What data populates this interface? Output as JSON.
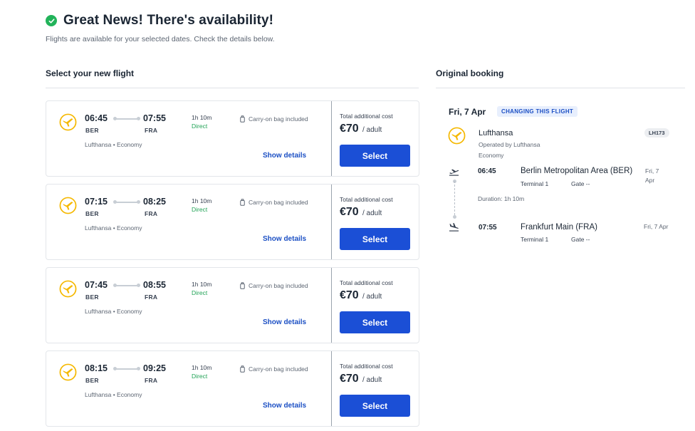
{
  "header": {
    "title": "Great News! There's availability!",
    "subtitle": "Flights are available for your selected dates. Check the details below."
  },
  "sections": {
    "new_flight": "Select your new flight",
    "original": "Original booking"
  },
  "colors": {
    "accent": "#1b4fd6",
    "success": "#22b35a",
    "logo": "#f5b800"
  },
  "flights": [
    {
      "dep_time": "06:45",
      "dep_code": "BER",
      "arr_time": "07:55",
      "arr_code": "FRA",
      "duration": "1h 10m",
      "stops": "Direct",
      "bag": "Carry-on bag included",
      "carrier": "Lufthansa • Economy",
      "details": "Show details",
      "cost_label": "Total additional cost",
      "price": "€70",
      "per": "/ adult",
      "select": "Select"
    },
    {
      "dep_time": "07:15",
      "dep_code": "BER",
      "arr_time": "08:25",
      "arr_code": "FRA",
      "duration": "1h 10m",
      "stops": "Direct",
      "bag": "Carry-on bag included",
      "carrier": "Lufthansa • Economy",
      "details": "Show details",
      "cost_label": "Total additional cost",
      "price": "€70",
      "per": "/ adult",
      "select": "Select"
    },
    {
      "dep_time": "07:45",
      "dep_code": "BER",
      "arr_time": "08:55",
      "arr_code": "FRA",
      "duration": "1h 10m",
      "stops": "Direct",
      "bag": "Carry-on bag included",
      "carrier": "Lufthansa • Economy",
      "details": "Show details",
      "cost_label": "Total additional cost",
      "price": "€70",
      "per": "/ adult",
      "select": "Select"
    },
    {
      "dep_time": "08:15",
      "dep_code": "BER",
      "arr_time": "09:25",
      "arr_code": "FRA",
      "duration": "1h 10m",
      "stops": "Direct",
      "bag": "Carry-on bag included",
      "carrier": "Lufthansa • Economy",
      "details": "Show details",
      "cost_label": "Total additional cost",
      "price": "€70",
      "per": "/ adult",
      "select": "Select"
    }
  ],
  "original": {
    "date": "Fri, 7 Apr",
    "badge": "CHANGING THIS FLIGHT",
    "airline": "Lufthansa",
    "operated": "Operated by Lufthansa",
    "cabin": "Economy",
    "flight_no": "LH173",
    "departure": {
      "time": "06:45",
      "airport": "Berlin Metropolitan Area (BER)",
      "date": "Fri, 7 Apr",
      "terminal": "Terminal  1",
      "gate": "Gate  --"
    },
    "duration": "Duration: 1h 10m",
    "arrival": {
      "time": "07:55",
      "airport": "Frankfurt Main (FRA)",
      "date": "Fri, 7 Apr",
      "terminal": "Terminal  1",
      "gate": "Gate  --"
    }
  }
}
